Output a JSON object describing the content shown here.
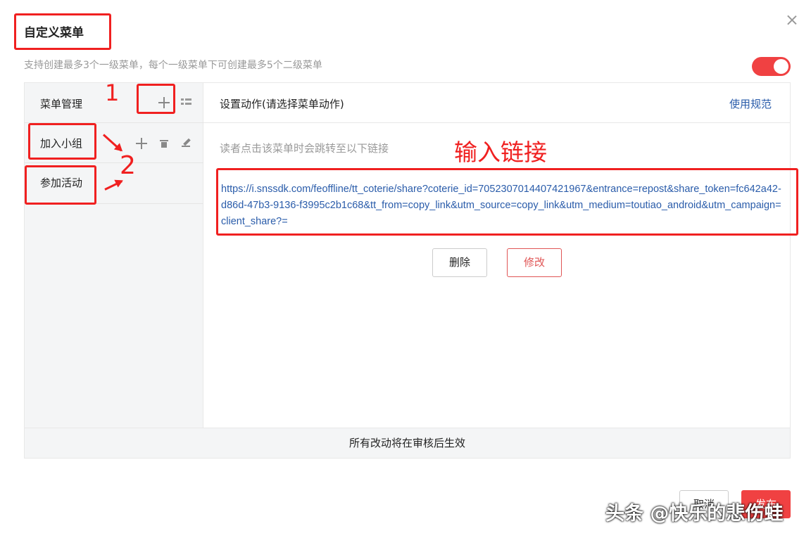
{
  "dialog": {
    "title": "自定义菜单",
    "subtitle": "支持创建最多3个一级菜单，每个一级菜单下可创建最多5个二级菜单",
    "toggle_on": true,
    "accent_color": "#f04142"
  },
  "sidebar": {
    "header_label": "菜单管理",
    "items": [
      {
        "label": "加入小组"
      },
      {
        "label": "参加活动"
      }
    ]
  },
  "main": {
    "header_label": "设置动作(请选择菜单动作)",
    "rules_link": "使用规范",
    "hint": "读者点击该菜单时会跳转至以下链接",
    "url": "https://i.snssdk.com/feoffline/tt_coterie/share?coterie_id=7052307014407421967&entrance=repost&share_token=fc642a42-d86d-47b3-9136-f3995c2b1c68&tt_from=copy_link&utm_source=copy_link&utm_medium=toutiao_android&utm_campaign=client_share?=",
    "delete_label": "删除",
    "edit_label": "修改"
  },
  "footer": {
    "note": "所有改动将在审核后生效",
    "cancel_label": "取消",
    "publish_label": "发布"
  },
  "annotations": {
    "step1": "1",
    "step2": "2",
    "input_link": "输入链接"
  },
  "watermark": "头条 @快乐的悲伤蛙"
}
